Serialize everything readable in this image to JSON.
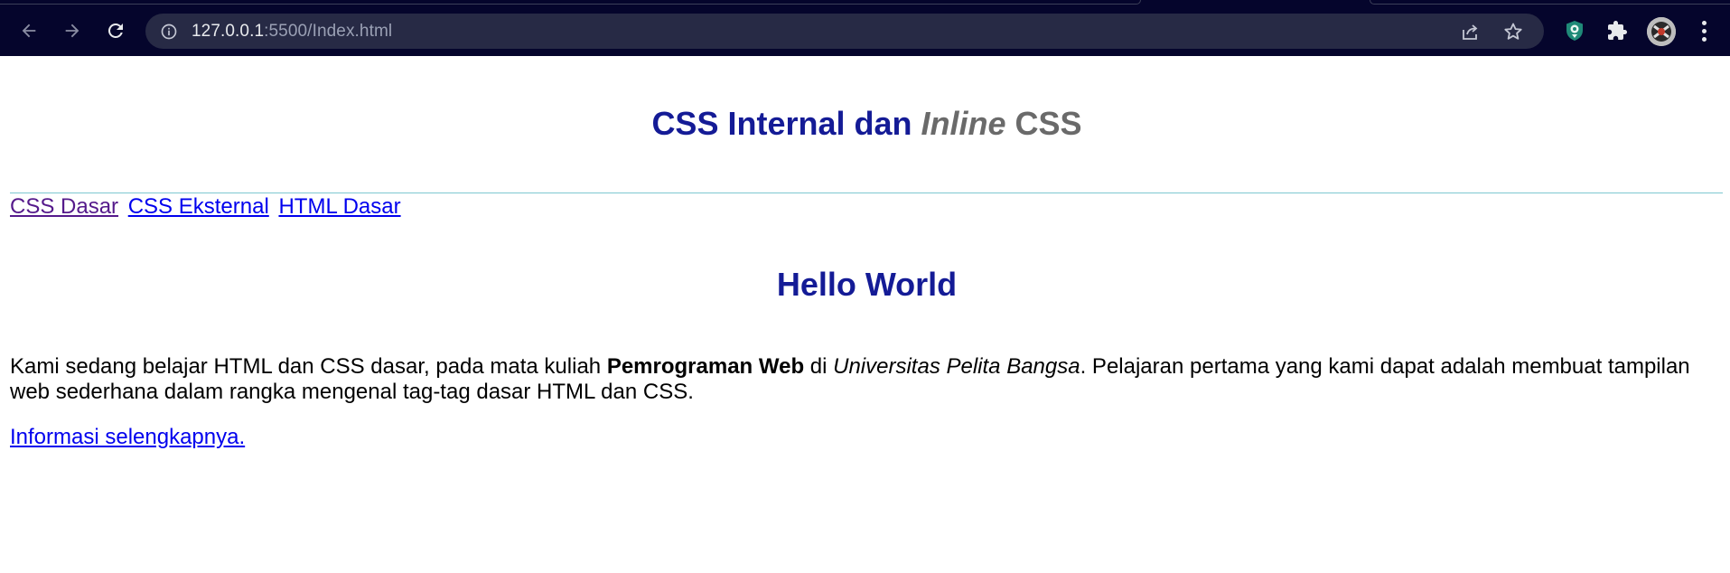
{
  "browser": {
    "url_host": "127.0.0.1",
    "url_path": ":5500/Index.html",
    "icons": {
      "back": "arrow-left-icon",
      "forward": "arrow-right-icon",
      "reload": "reload-icon",
      "site_info": "info-icon",
      "share": "share-icon",
      "bookmark": "star-icon",
      "extension_shield": "shield-extension-icon",
      "extensions": "puzzle-icon",
      "menu": "more-vert-icon"
    },
    "colors": {
      "frame": "#05052c",
      "omnibox": "#272a45"
    }
  },
  "page": {
    "title": {
      "part1": "CSS Internal dan ",
      "part2_italic": "Inline",
      "part3": " CSS"
    },
    "nav_links": [
      "CSS Dasar",
      "CSS Eksternal",
      "HTML Dasar"
    ],
    "heading": "Hello World",
    "paragraph": {
      "text1": "Kami sedang belajar HTML dan CSS dasar, pada mata kuliah ",
      "bold": "Pemrograman Web",
      "text2": " di ",
      "italic": "Universitas Pelita Bangsa",
      "text3": ". Pelajaran pertama yang kami dapat adalah membuat tampilan web sederhana dalam rangka mengenal tag-tag dasar HTML dan CSS."
    },
    "more_link": "Informasi selengkapnya.",
    "colors": {
      "heading": "#141b96",
      "title_grey": "#6a6a6a",
      "link": "#0000ee",
      "visited_link": "#551a8b",
      "divider": "#7ec8d0"
    }
  }
}
